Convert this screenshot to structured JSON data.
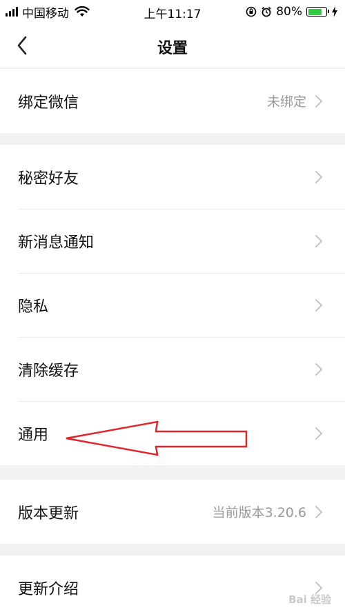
{
  "status_bar": {
    "carrier": "中国移动",
    "time": "上午11:17",
    "battery": "80%",
    "battery_level": 0.8
  },
  "nav": {
    "title": "设置",
    "back_icon": "chevron-left-icon"
  },
  "groups": [
    {
      "rows": [
        {
          "label": "绑定微信",
          "value": "未绑定"
        }
      ]
    },
    {
      "rows": [
        {
          "label": "秘密好友",
          "value": ""
        },
        {
          "label": "新消息通知",
          "value": ""
        },
        {
          "label": "隐私",
          "value": ""
        },
        {
          "label": "清除缓存",
          "value": ""
        },
        {
          "label": "通用",
          "value": ""
        }
      ]
    },
    {
      "rows": [
        {
          "label": "版本更新",
          "value": "当前版本3.20.6"
        }
      ]
    },
    {
      "rows": [
        {
          "label": "更新介绍",
          "value": ""
        }
      ]
    }
  ],
  "annotation": {
    "arrow_color": "#e0262b",
    "points_to": "通用"
  },
  "watermark": "Bai 经验"
}
